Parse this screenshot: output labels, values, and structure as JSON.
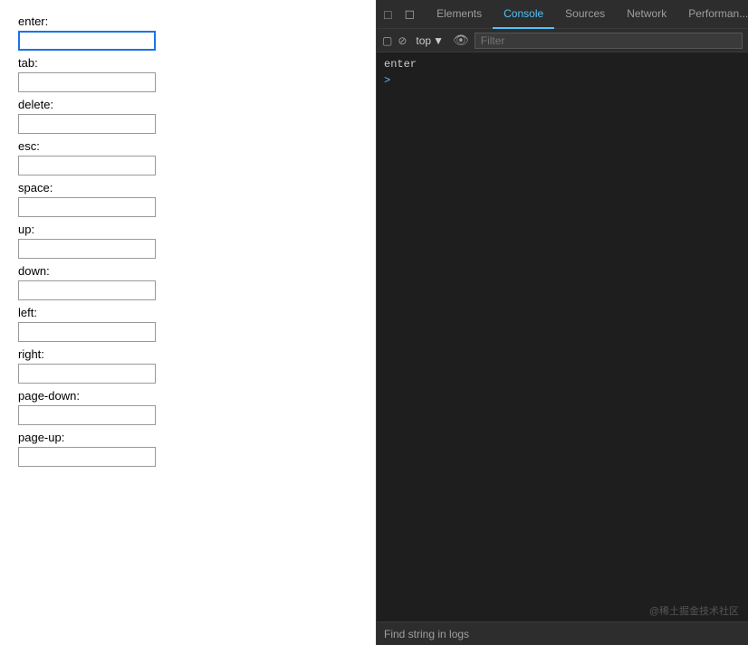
{
  "left": {
    "fields": [
      {
        "label": "enter:",
        "id": "enter",
        "focused": true
      },
      {
        "label": "tab:",
        "id": "tab",
        "focused": false
      },
      {
        "label": "delete:",
        "id": "delete",
        "focused": false
      },
      {
        "label": "esc:",
        "id": "esc",
        "focused": false
      },
      {
        "label": "space:",
        "id": "space",
        "focused": false
      },
      {
        "label": "up:",
        "id": "up",
        "focused": false
      },
      {
        "label": "down:",
        "id": "down",
        "focused": false
      },
      {
        "label": "left:",
        "id": "left",
        "focused": false
      },
      {
        "label": "right:",
        "id": "right",
        "focused": false
      },
      {
        "label": "page-down:",
        "id": "page-down",
        "focused": false
      },
      {
        "label": "page-up:",
        "id": "page-up",
        "focused": false
      }
    ]
  },
  "devtools": {
    "tabs": [
      {
        "label": "Elements",
        "active": false
      },
      {
        "label": "Console",
        "active": true
      },
      {
        "label": "Sources",
        "active": false
      },
      {
        "label": "Network",
        "active": false
      },
      {
        "label": "Performan...",
        "active": false
      }
    ],
    "top_dropdown": "top",
    "filter_placeholder": "Filter",
    "console_entry": "enter",
    "watermark": "@稀土掘金技术社区",
    "find_bar": "Find string in logs"
  }
}
